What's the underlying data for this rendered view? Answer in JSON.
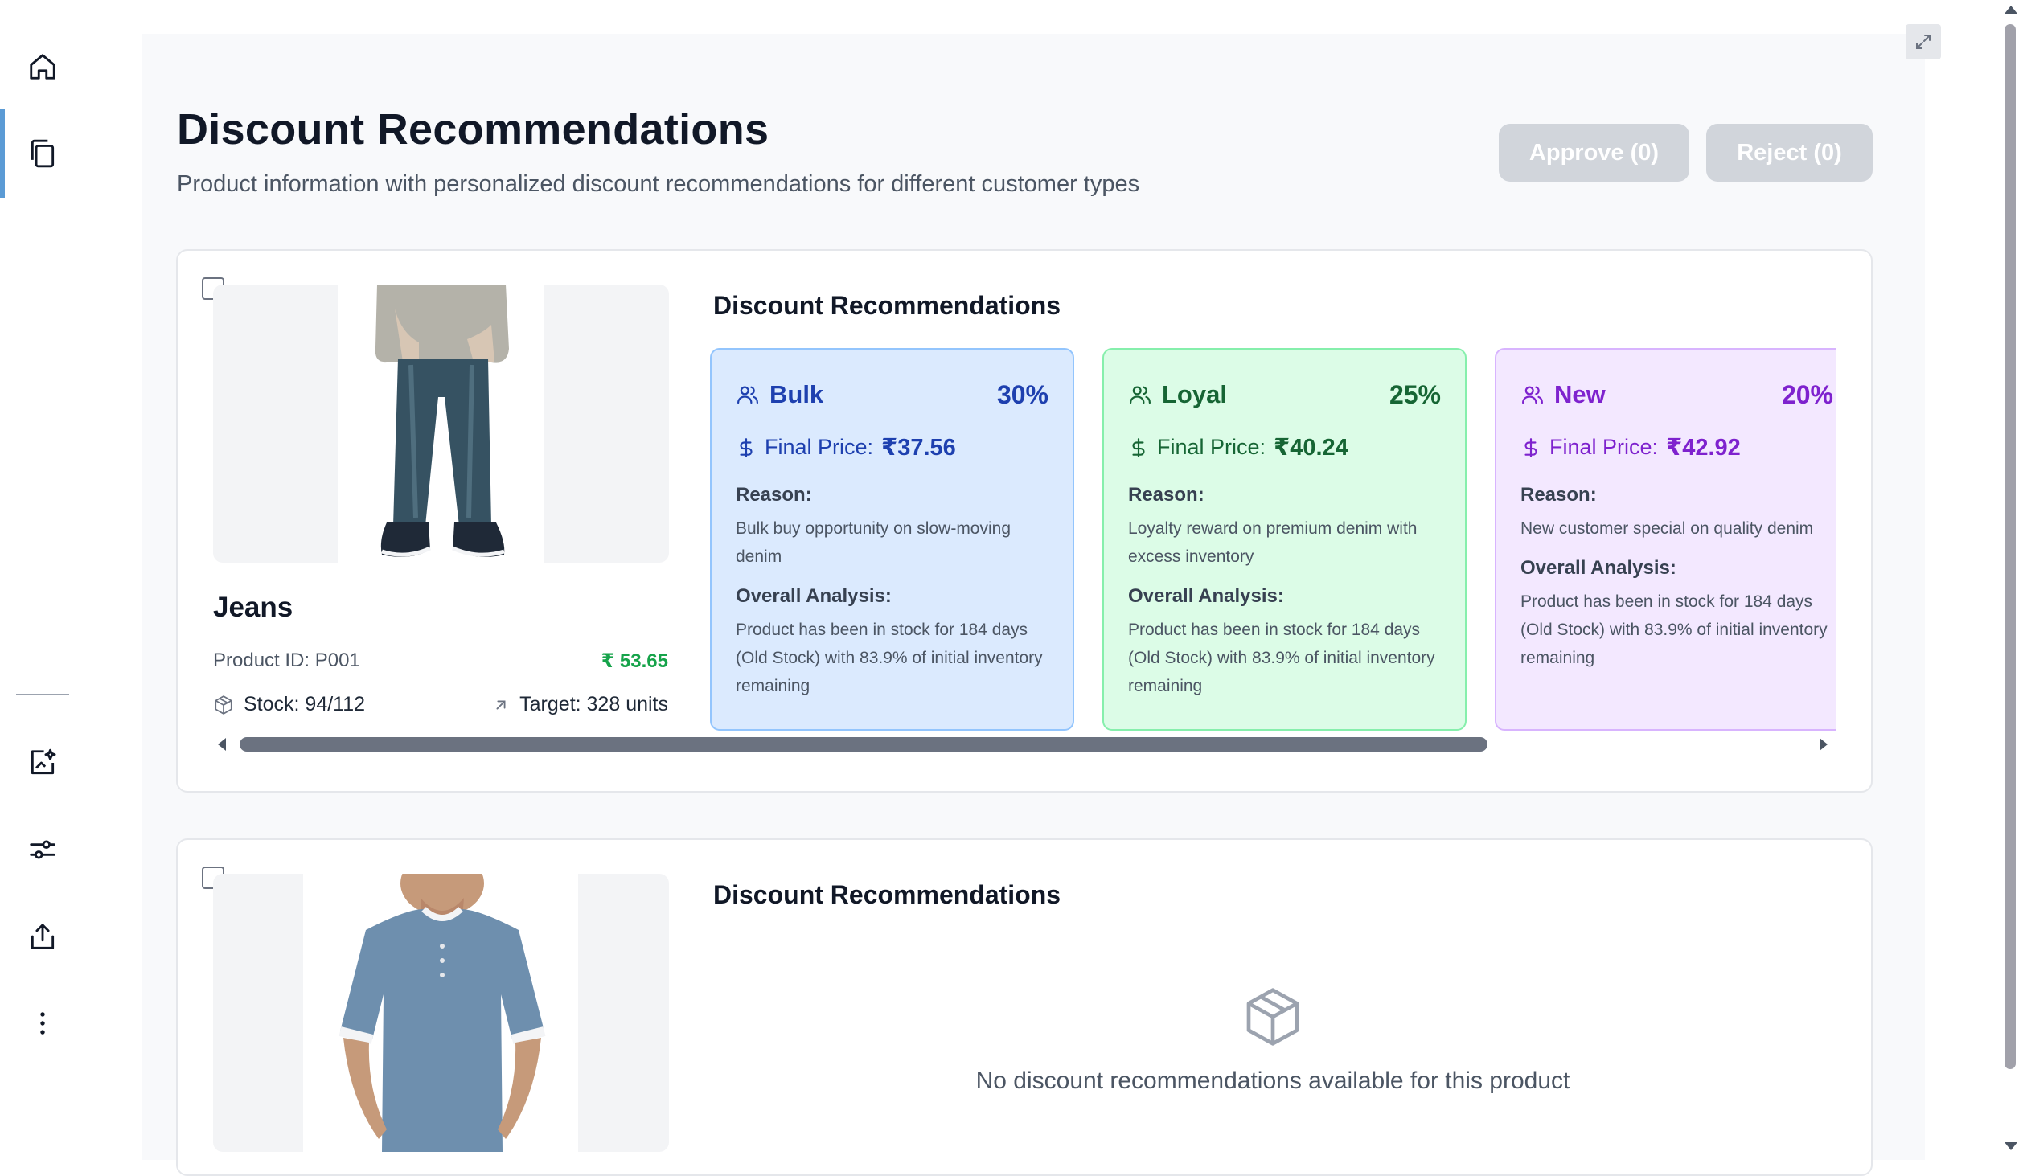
{
  "nav": {
    "items": [
      {
        "icon": "home-icon",
        "active": false
      },
      {
        "icon": "copy-icon",
        "active": true
      },
      {
        "icon": "chart-sparkle-icon",
        "active": false
      },
      {
        "icon": "sliders-icon",
        "active": false
      },
      {
        "icon": "share-icon",
        "active": false
      },
      {
        "icon": "more-vertical-icon",
        "active": false
      }
    ]
  },
  "header": {
    "title": "Discount Recommendations",
    "subtitle": "Product information with personalized discount recommendations for different customer types",
    "approve_label": "Approve (0)",
    "reject_label": "Reject (0)"
  },
  "products": [
    {
      "name": "Jeans",
      "id_label": "Product ID: P001",
      "price": "₹ 53.65",
      "stock": "Stock: 94/112",
      "target": "Target: 328 units",
      "section_title": "Discount Recommendations",
      "recommendations": [
        {
          "type": "Bulk",
          "percent": "30%",
          "price_label": "Final Price:",
          "price": "₹37.56",
          "reason_label": "Reason:",
          "reason": "Bulk buy opportunity on slow-moving denim",
          "analysis_label": "Overall Analysis:",
          "analysis": "Product has been in stock for 184 days (Old Stock) with 83.9% of initial inventory remaining",
          "color": "#1e40af"
        },
        {
          "type": "Loyal",
          "percent": "25%",
          "price_label": "Final Price:",
          "price": "₹40.24",
          "reason_label": "Reason:",
          "reason": "Loyalty reward on premium denim with excess inventory",
          "analysis_label": "Overall Analysis:",
          "analysis": "Product has been in stock for 184 days (Old Stock) with 83.9% of initial inventory remaining",
          "color": "#166534"
        },
        {
          "type": "New",
          "percent": "20%",
          "price_label": "Final Price:",
          "price": "₹42.92",
          "reason_label": "Reason:",
          "reason": "New customer special on quality denim",
          "analysis_label": "Overall Analysis:",
          "analysis": "Product has been in stock for 184 days (Old Stock) with 83.9% of initial inventory remaining",
          "color": "#7e22ce"
        }
      ]
    },
    {
      "section_title": "Discount Recommendations",
      "empty_message": "No discount recommendations available for this product"
    }
  ]
}
